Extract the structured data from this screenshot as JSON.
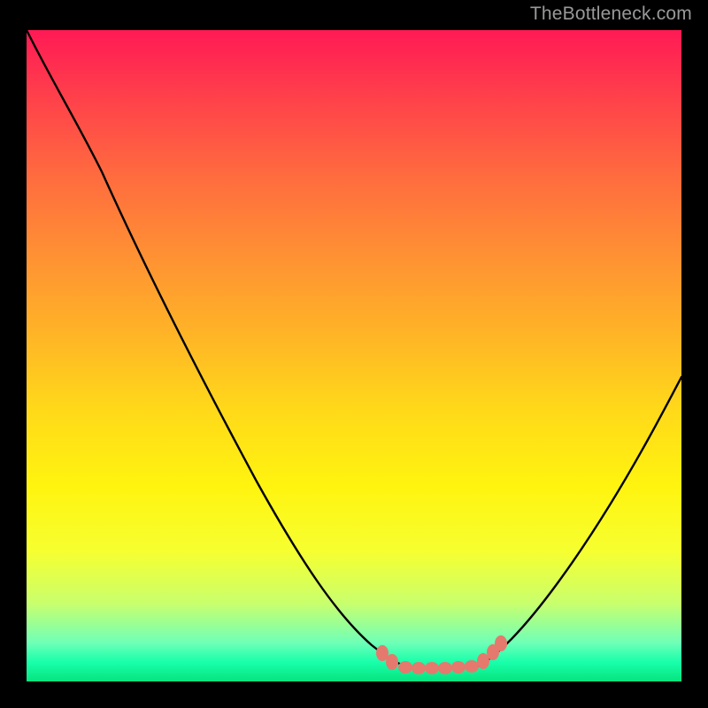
{
  "watermark": "TheBottleneck.com",
  "chart_data": {
    "type": "line",
    "title": "",
    "xlabel": "",
    "ylabel": "",
    "xlim": [
      0,
      100
    ],
    "ylim": [
      0,
      100
    ],
    "series": [
      {
        "name": "bottleneck-curve",
        "x": [
          0,
          6,
          12,
          18,
          24,
          30,
          36,
          42,
          48,
          52,
          55,
          58,
          60,
          62,
          65,
          68,
          70,
          72,
          76,
          80,
          85,
          90,
          95,
          100
        ],
        "values": [
          100,
          94,
          84,
          73,
          62,
          51,
          40,
          29,
          18,
          11,
          6,
          3,
          2,
          2,
          2,
          3,
          4,
          6,
          12,
          19,
          28,
          37,
          47,
          56
        ]
      }
    ],
    "highlight_range": {
      "x_start": 55,
      "x_end": 72
    },
    "gradient_stops": [
      {
        "offset": 0,
        "color": "#ff1a55"
      },
      {
        "offset": 70,
        "color": "#fff40f"
      },
      {
        "offset": 100,
        "color": "#06e47e"
      }
    ]
  }
}
